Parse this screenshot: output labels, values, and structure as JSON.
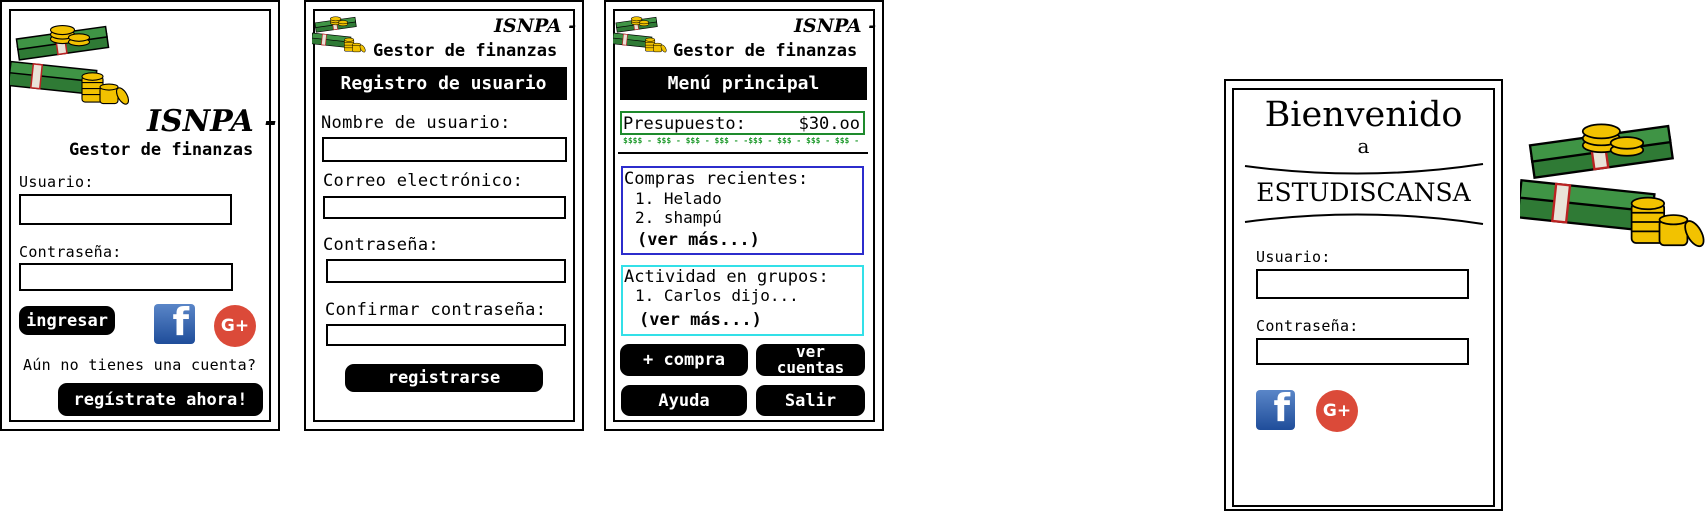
{
  "brand": {
    "name": "ISNPA -",
    "subtitle": "Gestor de finanzas"
  },
  "screen_login": {
    "user_label": "Usuario:",
    "password_label": "Contraseña:",
    "login_button": "ingresar",
    "facebook_glyph": "f",
    "google_glyph": "G+",
    "no_account_text": "Aún no tienes una cuenta?",
    "register_now_button": "regístrate ahora!"
  },
  "screen_register": {
    "header": "Registro de usuario",
    "username_label": "Nombre de usuario:",
    "email_label": "Correo electrónico:",
    "password_label": "Contraseña:",
    "confirm_label": "Confirmar contraseña:",
    "register_button": "registrarse"
  },
  "screen_menu": {
    "header": "Menú principal",
    "budget_label": "Presupuesto:",
    "budget_value": "$30.oo",
    "money_strip": "$$$$ - $$$ - $$$ - $$$ - -$$$ - $$$ - $$$ - $$$ -",
    "recent_title": "Compras recientes:",
    "recent_items": [
      "1. Helado",
      "2. shampú"
    ],
    "recent_more": "(ver más...)",
    "groups_title": "Actividad en grupos:",
    "groups_items": [
      "1. Carlos dijo..."
    ],
    "groups_more": "(ver más...)",
    "add_purchase_button": "+ compra",
    "view_accounts_button": "ver cuentas",
    "help_button": "Ayuda",
    "exit_button": "Salir"
  },
  "welcome": {
    "title": "Bienvenido",
    "connector": "a",
    "app_name": "ESTUDISCANSA",
    "user_label": "Usuario:",
    "password_label": "Contraseña:",
    "facebook_glyph": "f",
    "google_glyph": "G+"
  },
  "colors": {
    "ink": "#000000",
    "budget_border": "#1e8a2c",
    "money_strip": "#1e9a2c",
    "recent_border": "#2c2ccc",
    "groups_border": "#33e0e8",
    "facebook": "#3b5998",
    "google": "#db4a39"
  }
}
